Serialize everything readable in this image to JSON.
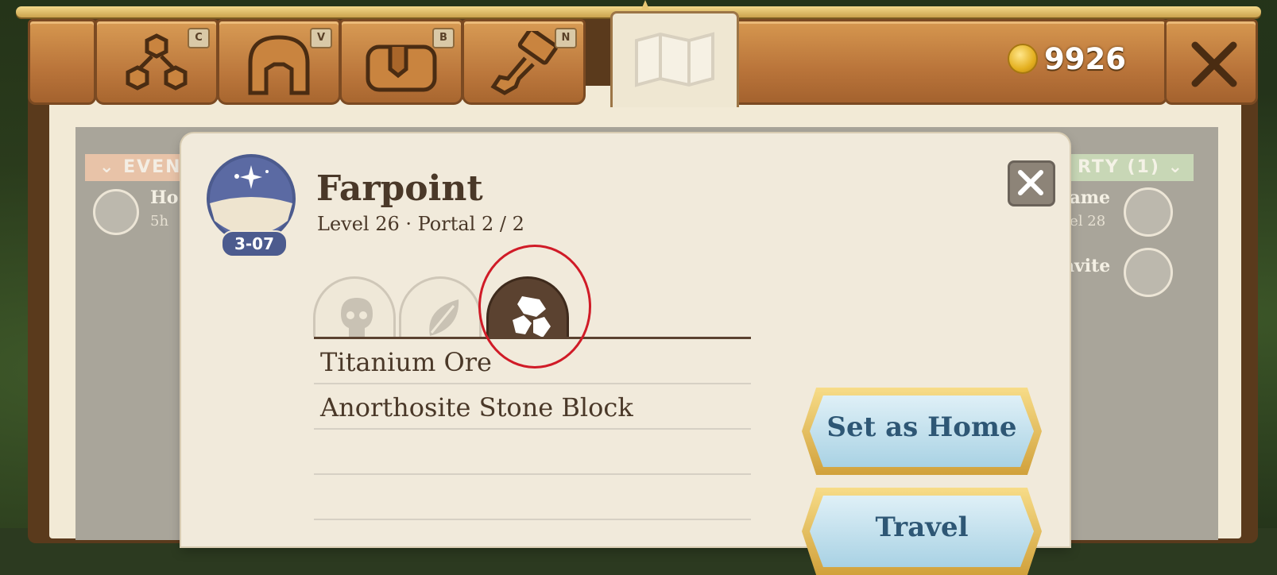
{
  "toolbar": {
    "tabs": [
      {
        "name": "skills",
        "key": "C"
      },
      {
        "name": "equipment",
        "key": "V"
      },
      {
        "name": "inventory",
        "key": "B"
      },
      {
        "name": "crafting",
        "key": "N"
      },
      {
        "name": "map",
        "key": ""
      }
    ],
    "currency": {
      "value": "9926"
    }
  },
  "side_left": {
    "banner": "EVEN",
    "item_title": "Ho",
    "item_sub": "5h"
  },
  "side_right": {
    "banner": "RTY (1)",
    "member_name": "fame",
    "member_level": "vel 28",
    "invite_label": "nvite"
  },
  "dialog": {
    "badge_label": "3-07",
    "title": "Farpoint",
    "subtitle": "Level 26 · Portal 2 / 2",
    "resource_tabs": [
      {
        "name": "creatures",
        "active": false
      },
      {
        "name": "plants",
        "active": false
      },
      {
        "name": "minerals",
        "active": true
      }
    ],
    "resources": [
      "Titanium Ore",
      "Anorthosite Stone Block",
      "",
      ""
    ],
    "buttons": {
      "set_home": "Set as Home",
      "travel": "Travel"
    }
  },
  "colors": {
    "highlight": "#d01b27",
    "badge": "#4c5b8e",
    "button_text": "#2e5775"
  }
}
